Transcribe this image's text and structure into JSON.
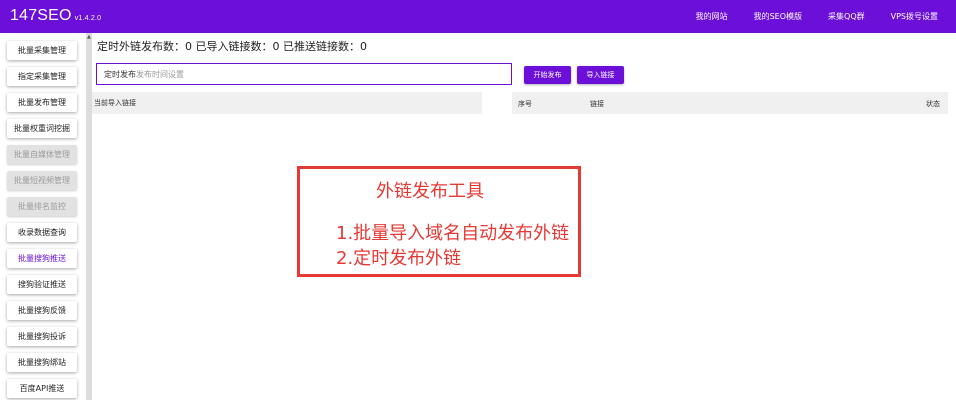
{
  "app": {
    "name": "147SEO",
    "version": "v1.4.2.0"
  },
  "topnav": [
    "我的网站",
    "我的SEO模版",
    "采集QQ群",
    "VPS拨号设置"
  ],
  "sidebar": [
    {
      "label": "批量采集管理",
      "state": "normal"
    },
    {
      "label": "指定采集管理",
      "state": "normal"
    },
    {
      "label": "批量发布管理",
      "state": "normal"
    },
    {
      "label": "批量权重词挖掘",
      "state": "normal"
    },
    {
      "label": "批量自媒体管理",
      "state": "disabled"
    },
    {
      "label": "批量短视频管理",
      "state": "disabled"
    },
    {
      "label": "批量排名监控",
      "state": "disabled"
    },
    {
      "label": "收录数据查询",
      "state": "normal"
    },
    {
      "label": "批量搜狗推送",
      "state": "active"
    },
    {
      "label": "搜狗验证推送",
      "state": "normal"
    },
    {
      "label": "批量搜狗反馈",
      "state": "normal"
    },
    {
      "label": "批量搜狗投诉",
      "state": "normal"
    },
    {
      "label": "批量搜狗绑站",
      "state": "normal"
    },
    {
      "label": "百度API推送",
      "state": "normal"
    }
  ],
  "main": {
    "stats": "定时外链发布数：0 已导入链接数：0 已推送链接数：0",
    "schedule_input": {
      "label": "定时发布",
      "placeholder": "发布时间设置"
    },
    "start_button": "开始发布",
    "import_button": "导入链接",
    "left_panel_header": "当前导入链接",
    "table_headers": [
      "序号",
      "链接",
      "状态"
    ]
  },
  "overlay": {
    "title": "外链发布工具",
    "lines": [
      "1.批量导入域名自动发布外链",
      "2.定时发布外链"
    ]
  },
  "colors": {
    "accent": "#6b0fd9",
    "annotation": "#e53935"
  }
}
